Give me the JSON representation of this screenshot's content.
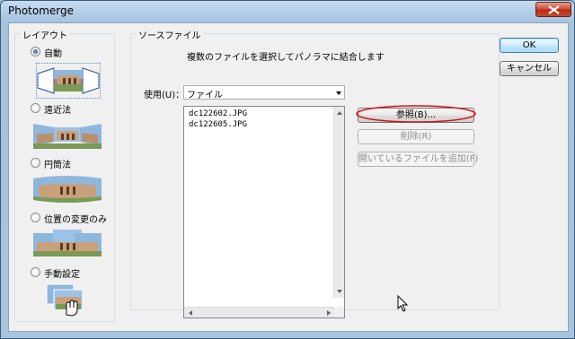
{
  "window": {
    "title": "Photomerge"
  },
  "layout_group": {
    "title": "レイアウト",
    "options": [
      {
        "label": "自動",
        "checked": true
      },
      {
        "label": "遠近法",
        "checked": false
      },
      {
        "label": "円筒法",
        "checked": false
      },
      {
        "label": "位置の変更のみ",
        "checked": false
      },
      {
        "label": "手動設定",
        "checked": false
      }
    ]
  },
  "source_group": {
    "title": "ソースファイル",
    "instruction": "複数のファイルを選択してパノラマに結合します",
    "use_label": "使用(U)：",
    "use_value": "ファイル",
    "files": [
      "dc122602.JPG",
      "dc122605.JPG"
    ],
    "buttons": {
      "browse": "参照(B)...",
      "remove": "削除(R)",
      "add_open": "開いているファイルを追加(F)"
    }
  },
  "dialog_buttons": {
    "ok": "OK",
    "cancel": "キャンセル"
  },
  "colors": {
    "highlight_ellipse": "#d0141a",
    "accent": "#3c7fb1"
  }
}
